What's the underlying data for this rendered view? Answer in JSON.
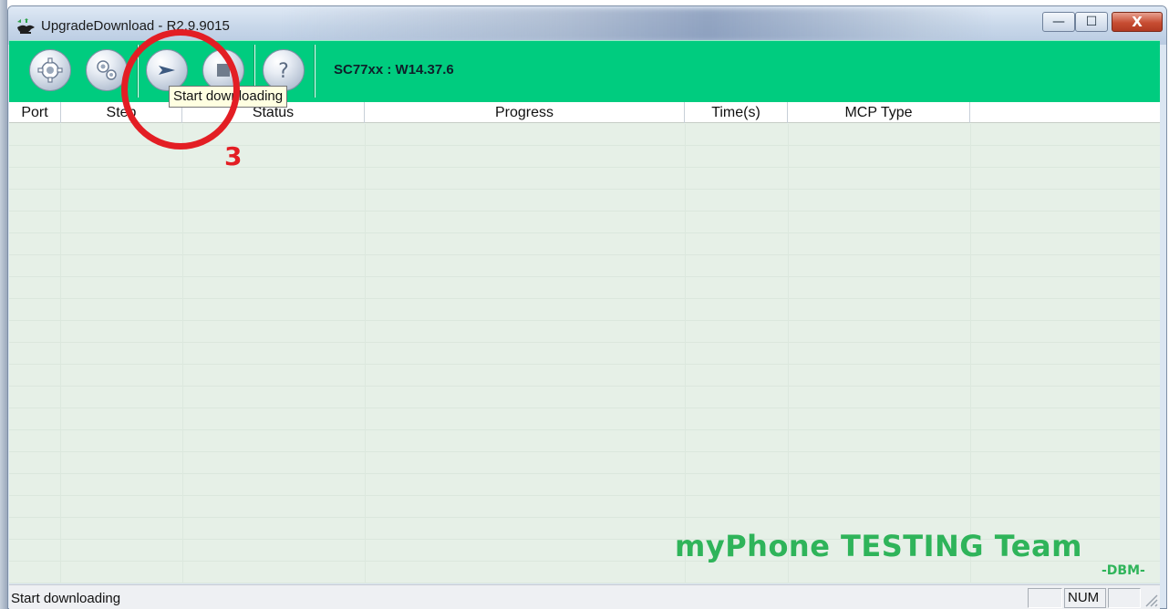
{
  "window": {
    "title": "UpgradeDownload - R2.9.9015",
    "controls": {
      "minimize": "—",
      "maximize": "☐",
      "close": "X"
    }
  },
  "toolbar": {
    "buttons": [
      {
        "name": "settings",
        "icon": "gear-icon",
        "tooltip": ""
      },
      {
        "name": "options",
        "icon": "gears-icon",
        "tooltip": ""
      },
      {
        "name": "start",
        "icon": "arrow-right-icon",
        "tooltip": "Start downloading"
      },
      {
        "name": "stop",
        "icon": "stop-icon",
        "tooltip": ""
      },
      {
        "name": "help",
        "icon": "question-icon",
        "tooltip": ""
      }
    ],
    "version_label": "SC77xx : W14.37.6",
    "tooltip_visible": "Start downloading"
  },
  "table": {
    "columns": [
      "Port",
      "Step",
      "Status",
      "Progress",
      "Time(s)",
      "MCP Type"
    ],
    "rows": []
  },
  "watermark": {
    "text": "myPhone TESTING Team",
    "signature": "-DBM-"
  },
  "annotation": {
    "step_number": "3",
    "color": "#e31e24"
  },
  "statusbar": {
    "text": "Start downloading",
    "num_indicator": "NUM"
  },
  "colors": {
    "toolbar": "#00cc7f",
    "list_background": "#e6f0e7",
    "watermark": "#2fb45a"
  }
}
